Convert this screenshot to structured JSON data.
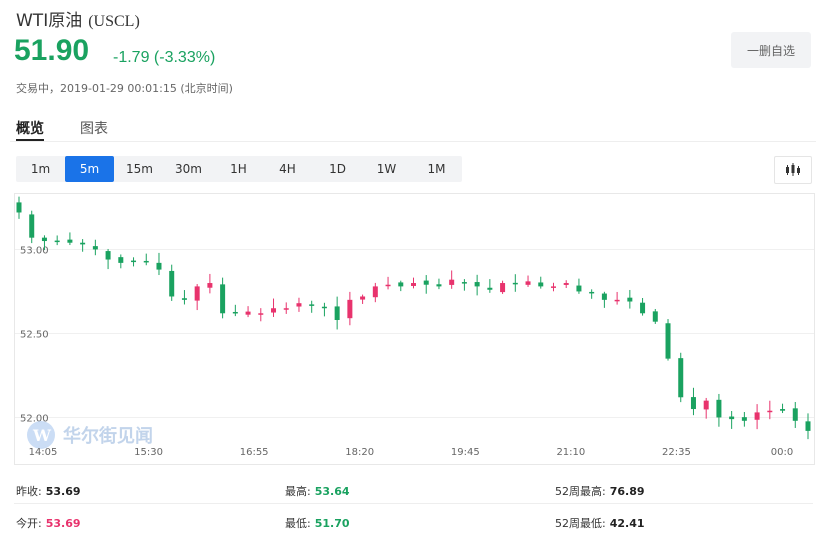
{
  "header": {
    "title": "WTI原油",
    "symbol": "(USCL)",
    "price": "51.90",
    "change": "-1.79 (-3.33%)",
    "status": "交易中，2019-01-29 00:01:15 (北京时间)",
    "watch_label": "一删自选"
  },
  "tabs": [
    {
      "label": "概览",
      "active": true
    },
    {
      "label": "图表",
      "active": false
    }
  ],
  "periods": [
    "1m",
    "5m",
    "15m",
    "30m",
    "1H",
    "4H",
    "1D",
    "1W",
    "1M"
  ],
  "active_period": "5m",
  "icons": {
    "chart_type": "candlestick-icon"
  },
  "colors": {
    "up": "#e8336d",
    "down": "#1aa260",
    "accent": "#1a73e8"
  },
  "watermark": {
    "text": "华尔街见闻"
  },
  "stats": {
    "prev_close": {
      "label": "昨收:",
      "value": "53.69"
    },
    "open": {
      "label": "今开:",
      "value": "53.69"
    },
    "high": {
      "label": "最高:",
      "value": "53.64"
    },
    "low": {
      "label": "最低:",
      "value": "51.70"
    },
    "week52_high": {
      "label": "52周最高:",
      "value": "76.89"
    },
    "week52_low": {
      "label": "52周最低:",
      "value": "42.41"
    }
  },
  "chart_data": {
    "type": "candlestick",
    "interval": "5m",
    "x_tick_labels": [
      "14:05",
      "15:30",
      "16:55",
      "18:20",
      "19:45",
      "21:10",
      "22:35",
      "00:0"
    ],
    "y_tick_labels": [
      "53.00",
      "52.50",
      "52.00"
    ],
    "ylim": [
      51.83,
      53.33
    ],
    "grid": true,
    "up_color": "#e8336d",
    "down_color": "#1aa260",
    "close_path": [
      53.22,
      53.07,
      53.05,
      53.05,
      53.04,
      53.03,
      53.0,
      52.94,
      52.92,
      52.93,
      52.93,
      52.88,
      52.72,
      52.7,
      52.78,
      52.8,
      52.62,
      52.62,
      52.63,
      52.62,
      52.65,
      52.65,
      52.68,
      52.67,
      52.65,
      52.58,
      52.7,
      52.72,
      52.78,
      52.79,
      52.78,
      52.8,
      52.79,
      52.78,
      52.82,
      52.8,
      52.78,
      52.76,
      52.8,
      52.8,
      52.81,
      52.78,
      52.78,
      52.8,
      52.75,
      52.74,
      52.7,
      52.7,
      52.69,
      52.62,
      52.57,
      52.35,
      52.12,
      52.05,
      52.1,
      52.0,
      51.99,
      51.98,
      52.03,
      52.04,
      52.04,
      51.98,
      51.92
    ]
  }
}
